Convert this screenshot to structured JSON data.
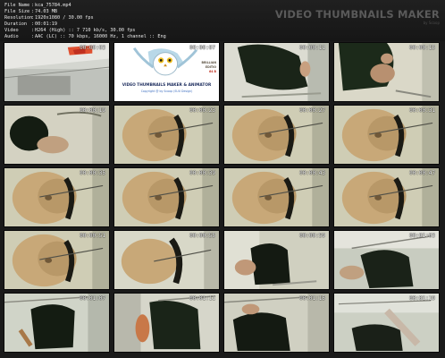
{
  "info": [
    {
      "label": "File Name",
      "value": "kca_75784.mp4"
    },
    {
      "label": "File Size",
      "value": "74.03 MB"
    },
    {
      "label": "Resolution",
      "value": "1920x1080 / 30.00 fps"
    },
    {
      "label": "Duration",
      "value": "00:01:19"
    },
    {
      "label": "Video",
      "value": "H264 (High) :: 7 710 kb/s, 30.00 fps"
    },
    {
      "label": "Audio",
      "value": "AAC (LC) :: 70 kbps, 16000 Hz, 1 channel :: Eng"
    }
  ],
  "brand": {
    "title": "VIDEO THUMBNAILS MAKER",
    "sub": "by Scoop"
  },
  "logo": {
    "title": "VIDEO THUMBNAILS MAKER & ANIMATOR",
    "copyright": "Copyright @ by Scoop (SUU Design)",
    "side1": "BRILLIAN",
    "side2": "EDITIO",
    "side3": "64 B"
  },
  "thumbnails": [
    {
      "time": "00:00:03",
      "scene": "room"
    },
    {
      "time": "00:00:07",
      "scene": "logo"
    },
    {
      "time": "00:00:11",
      "scene": "figure-a"
    },
    {
      "time": "00:00:15",
      "scene": "figure-b"
    },
    {
      "time": "00:00:19",
      "scene": "figure-c"
    },
    {
      "time": "00:00:23",
      "scene": "round"
    },
    {
      "time": "00:00:27",
      "scene": "round"
    },
    {
      "time": "00:00:31",
      "scene": "round"
    },
    {
      "time": "00:00:35",
      "scene": "round"
    },
    {
      "time": "00:00:39",
      "scene": "round"
    },
    {
      "time": "00:00:43",
      "scene": "round"
    },
    {
      "time": "00:00:47",
      "scene": "round"
    },
    {
      "time": "00:00:51",
      "scene": "round"
    },
    {
      "time": "00:00:55",
      "scene": "figure-d"
    },
    {
      "time": "00:00:59",
      "scene": "figure-e"
    },
    {
      "time": "00:01:03",
      "scene": "figure-f"
    },
    {
      "time": "00:01:07",
      "scene": "figure-g"
    },
    {
      "time": "00:01:11",
      "scene": "figure-h"
    },
    {
      "time": "00:01:15",
      "scene": "figure-i"
    },
    {
      "time": "00:01:19",
      "scene": "figure-j"
    }
  ]
}
